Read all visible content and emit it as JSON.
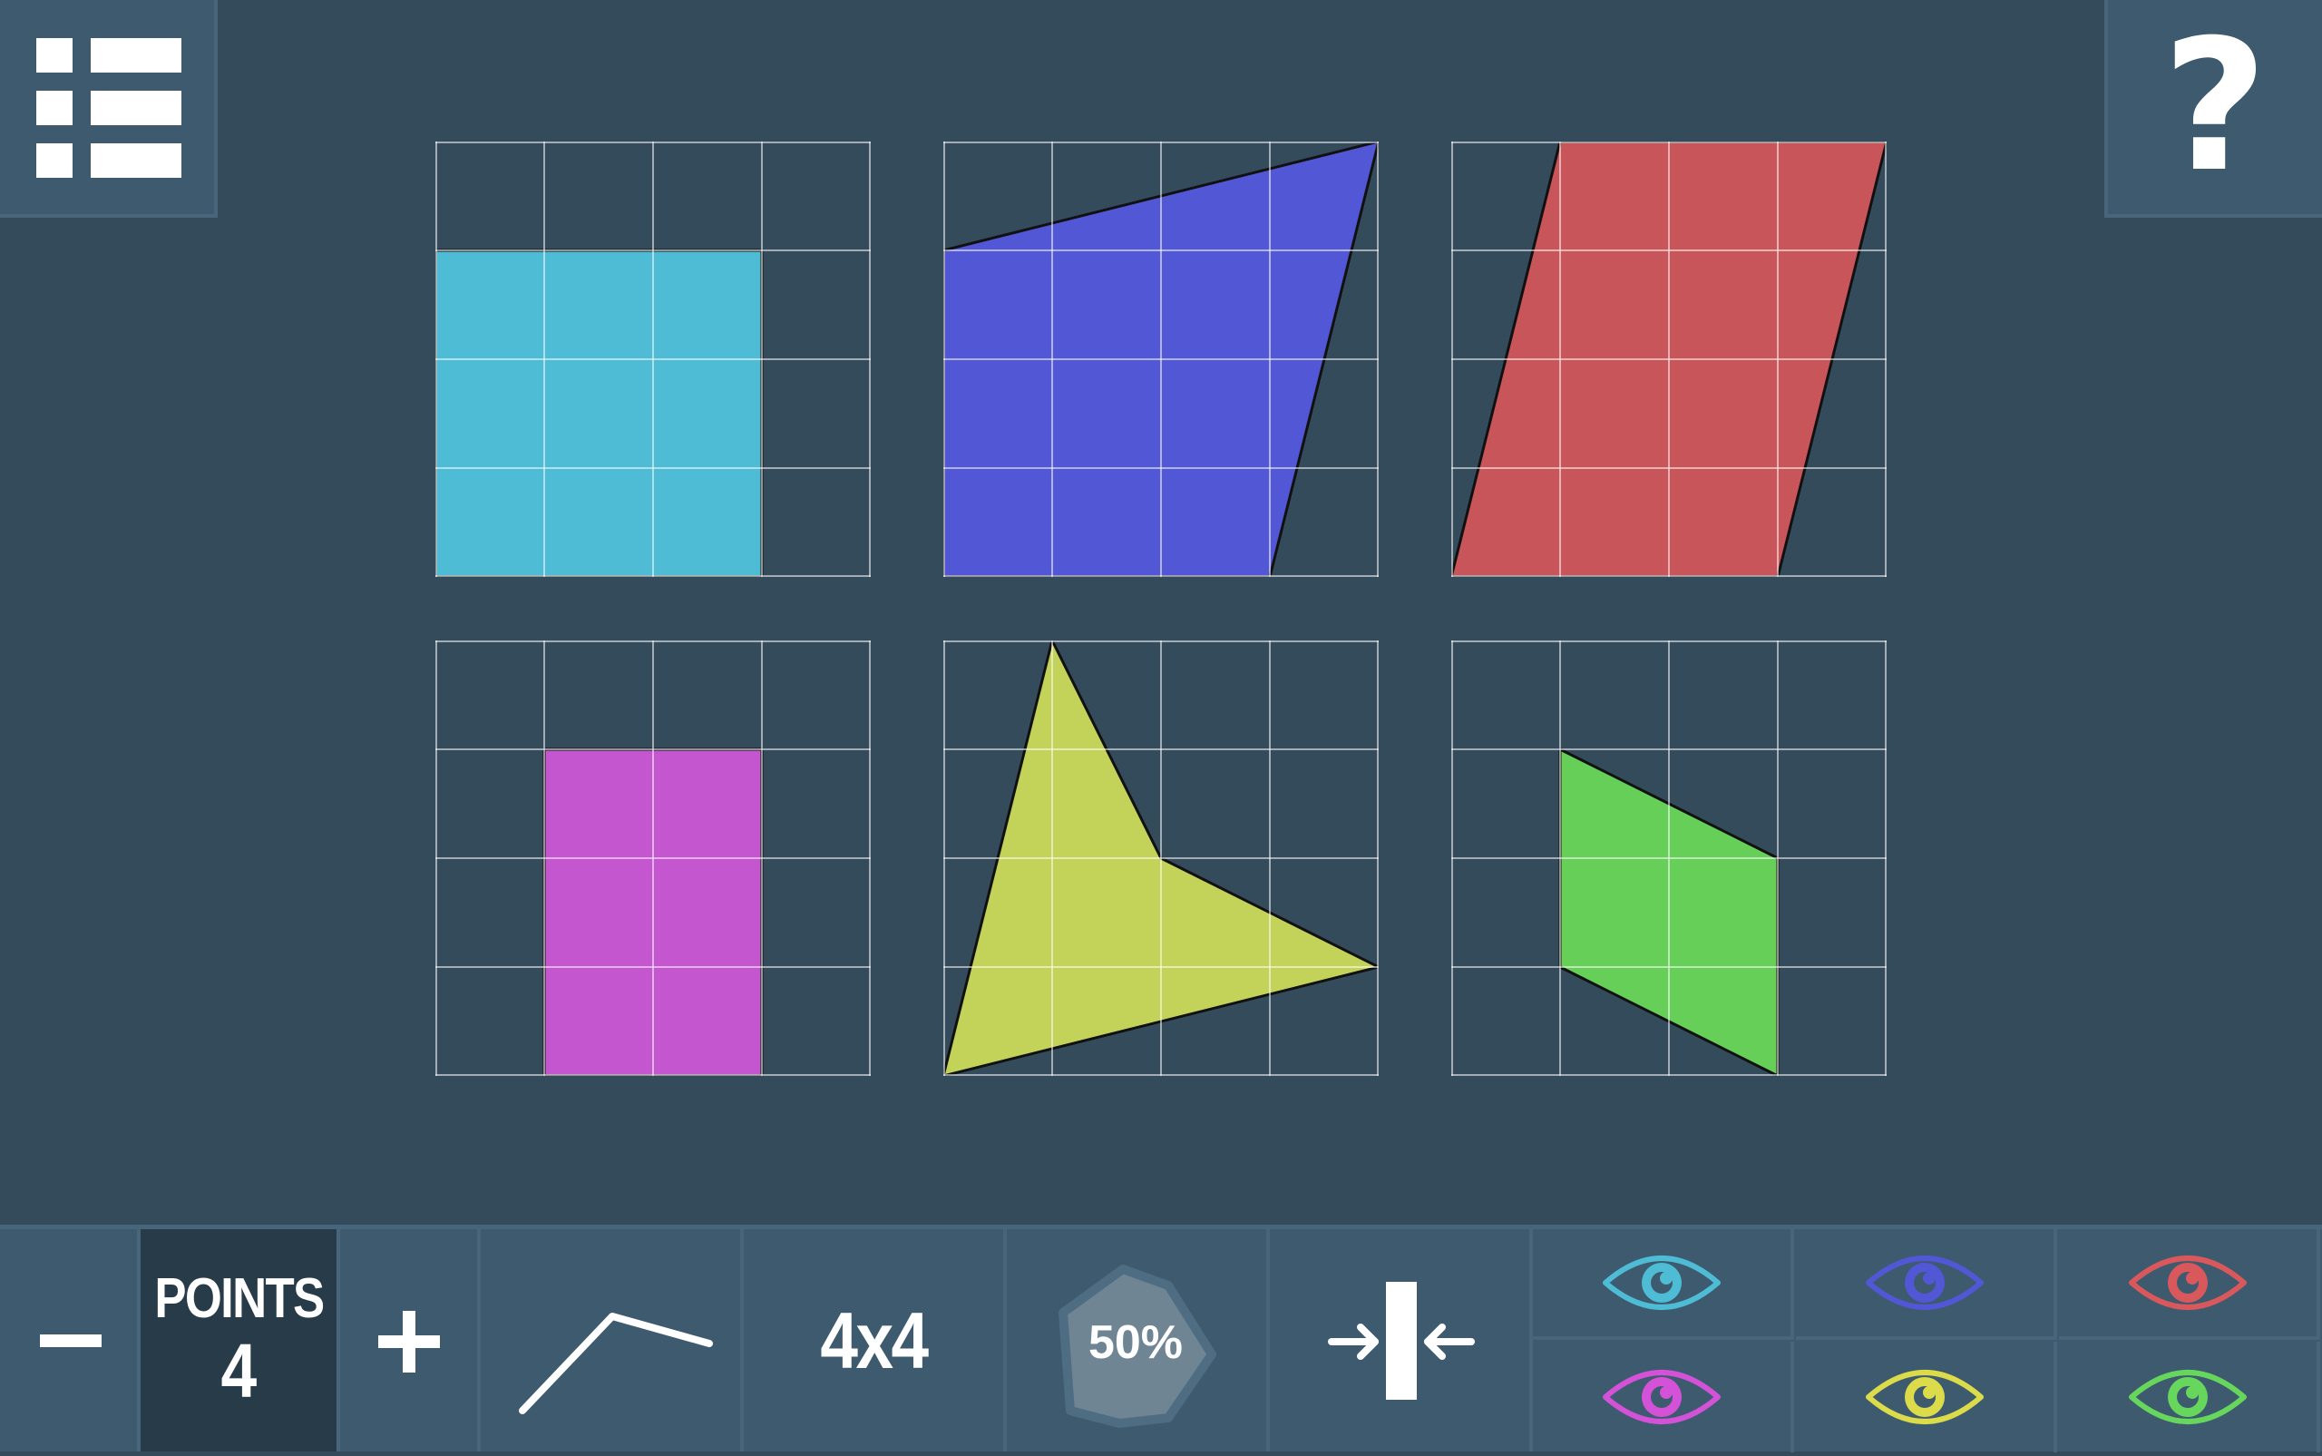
{
  "header": {
    "menu_icon": "list-menu-icon",
    "help_label": "?"
  },
  "shapes": [
    {
      "color": "#4dbcd4",
      "vertices": [
        [
          0,
          1
        ],
        [
          3,
          1
        ],
        [
          3,
          4
        ],
        [
          0,
          4
        ]
      ]
    },
    {
      "color": "#5257d6",
      "vertices": [
        [
          0,
          1
        ],
        [
          4,
          0
        ],
        [
          3,
          4
        ],
        [
          0,
          4
        ]
      ]
    },
    {
      "color": "#c8555a",
      "vertices": [
        [
          1,
          0
        ],
        [
          4,
          0
        ],
        [
          3,
          4
        ],
        [
          0,
          4
        ]
      ]
    },
    {
      "color": "#c456d0",
      "vertices": [
        [
          1,
          1
        ],
        [
          3,
          1
        ],
        [
          3,
          4
        ],
        [
          1,
          4
        ]
      ]
    },
    {
      "color": "#c3d35a",
      "vertices": [
        [
          1,
          0
        ],
        [
          2,
          2
        ],
        [
          4,
          3
        ],
        [
          0,
          4
        ]
      ]
    },
    {
      "color": "#66cf58",
      "vertices": [
        [
          1,
          1
        ],
        [
          3,
          2
        ],
        [
          3,
          4
        ],
        [
          1,
          3
        ]
      ]
    }
  ],
  "grid": {
    "rows": 4,
    "cols": 4
  },
  "toolbar": {
    "minus_label": "−",
    "points_label": "POINTS",
    "points_value": "4",
    "plus_label": "+",
    "line_icon": "polyline-icon",
    "grid_size_label": "4x4",
    "percent_label": "50%",
    "compress_icon": "compress-icon"
  },
  "visibility_toggles": [
    {
      "color": "#4dbcd4",
      "icon": "eye-icon"
    },
    {
      "color": "#5257d6",
      "icon": "eye-icon"
    },
    {
      "color": "#d9585c",
      "icon": "eye-icon"
    },
    {
      "color": "#d452d8",
      "icon": "eye-icon"
    },
    {
      "color": "#dcdc4a",
      "icon": "eye-icon"
    },
    {
      "color": "#66d65c",
      "icon": "eye-icon"
    }
  ]
}
